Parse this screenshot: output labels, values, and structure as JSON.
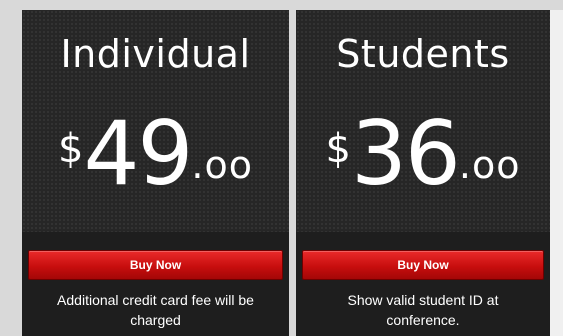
{
  "plans": [
    {
      "title": "Individual",
      "currency": "$",
      "price_whole": "49",
      "price_cents": ".oo",
      "button_label": "Buy Now",
      "note": "Additional credit card fee will be charged"
    },
    {
      "title": "Students",
      "currency": "$",
      "price_whole": "36",
      "price_cents": ".oo",
      "button_label": "Buy Now",
      "note": "Show valid student ID at conference."
    }
  ],
  "colors": {
    "card_background": "#262626",
    "button_red": "#d01515",
    "page_background": "#d9d9d9"
  }
}
